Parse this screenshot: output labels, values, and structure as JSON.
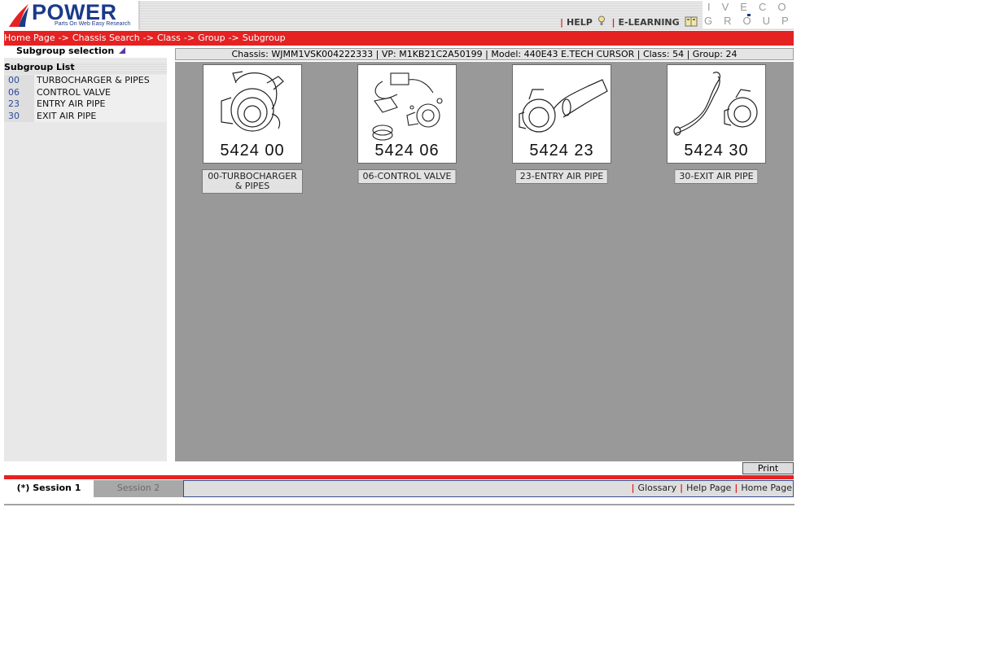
{
  "header": {
    "logo_text": "POWER",
    "logo_tagline": "Parts On Web Easy Research",
    "links": [
      "HELP",
      "E-LEARNING"
    ],
    "brand_top": "IVECO",
    "brand_bottom": "GROUP"
  },
  "breadcrumb": [
    "Home Page",
    "Chassis Search",
    "Class",
    "Group",
    "Subgroup"
  ],
  "breadcrumb_sep": "->",
  "left": {
    "selection_title": "Subgroup selection",
    "list_title": "Subgroup List",
    "items": [
      {
        "code": "00",
        "name": "TURBOCHARGER & PIPES"
      },
      {
        "code": "06",
        "name": "CONTROL VALVE"
      },
      {
        "code": "23",
        "name": "ENTRY AIR PIPE"
      },
      {
        "code": "30",
        "name": "EXIT AIR PIPE"
      }
    ]
  },
  "chassis_info": "Chassis: WJMM1VSK004222333 | VP: M1KB21C2A50199 | Model: 440E43 E.TECH CURSOR | Class: 54 | Group: 24",
  "cards": [
    {
      "number": "5424 00",
      "caption": "00-TURBOCHARGER & PIPES"
    },
    {
      "number": "5424 06",
      "caption": "06-CONTROL VALVE"
    },
    {
      "number": "5424 23",
      "caption": "23-ENTRY AIR PIPE"
    },
    {
      "number": "5424 30",
      "caption": "30-EXIT AIR PIPE"
    }
  ],
  "print_label": "Print",
  "footer": {
    "session1": "(*) Session 1",
    "session2": "Session 2",
    "links": [
      "Glossary",
      "Help Page",
      "Home Page"
    ]
  },
  "colors": {
    "accent_red": "#e52222",
    "brand_blue": "#1a3a8a",
    "gallery_bg": "#999999"
  }
}
